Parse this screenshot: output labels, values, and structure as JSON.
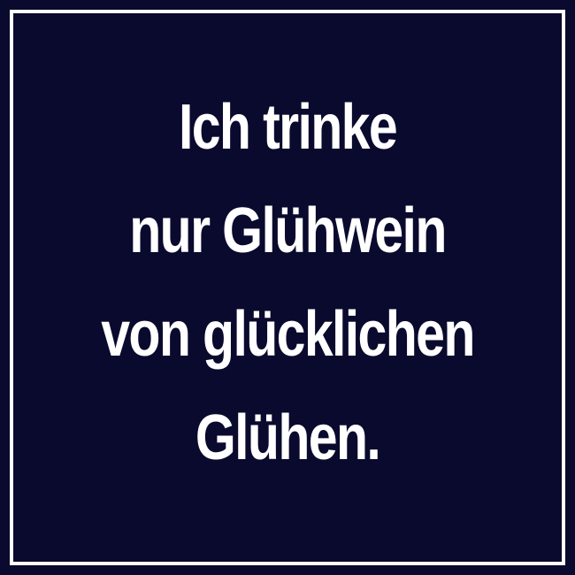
{
  "quote": {
    "lines": [
      "Ich trinke",
      "nur Glühwein",
      "von glücklichen",
      "Glühen."
    ]
  },
  "colors": {
    "background": "#0a0a2e",
    "frame": "#ffffff",
    "text": "#ffffff"
  }
}
